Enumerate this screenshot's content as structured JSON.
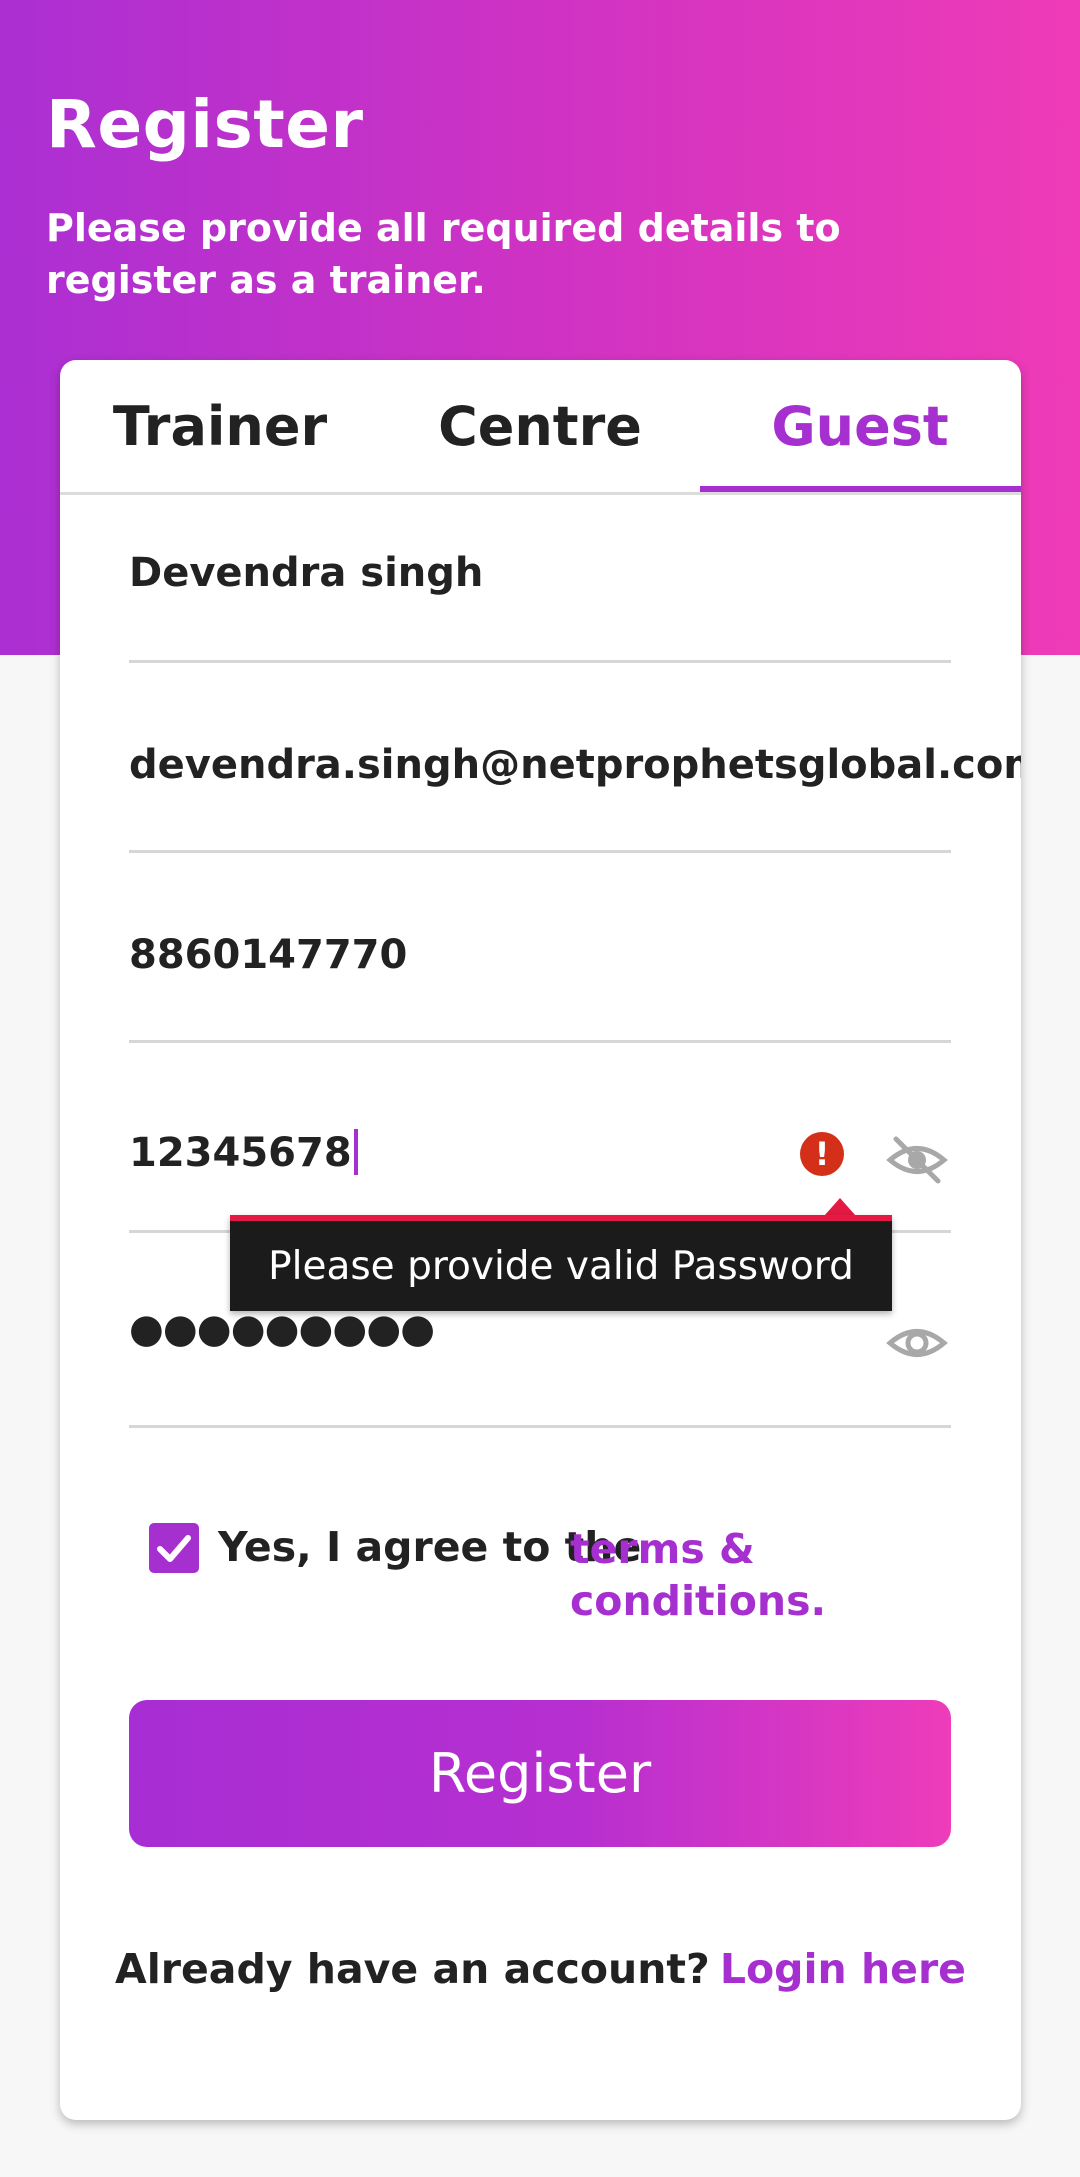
{
  "header": {
    "title": "Register",
    "subtitle": "Please provide all required details to register as a trainer."
  },
  "tabs": [
    {
      "label": "Trainer",
      "selected": false
    },
    {
      "label": "Centre",
      "selected": false
    },
    {
      "label": "Guest",
      "selected": true
    }
  ],
  "form": {
    "name": "Devendra singh",
    "email": "devendra.singh@netprophetsglobal.com",
    "phone": "8860147770",
    "password": "12345678",
    "confirm_password_mask": "●●●●●●●●●",
    "error_tooltip": "Please provide valid Password",
    "error_icon_text": "!"
  },
  "agreement": {
    "checked": true,
    "text": "Yes, I agree to the",
    "link_text": "terms & conditions."
  },
  "register_button": "Register",
  "footer": {
    "text": "Already have an account?",
    "link_text": "Login here"
  },
  "icons": {
    "password_toggle": "eye-off-icon",
    "confirm_toggle": "eye-icon",
    "error": "error-icon",
    "checkbox": "check-icon"
  },
  "colors": {
    "accent": "#a52fcf",
    "gradient_start": "#ab2fd3",
    "gradient_end": "#ef3bb7",
    "error": "#d32f19",
    "tooltip_bg": "#1b1b1b",
    "tooltip_border": "#e31a43"
  }
}
